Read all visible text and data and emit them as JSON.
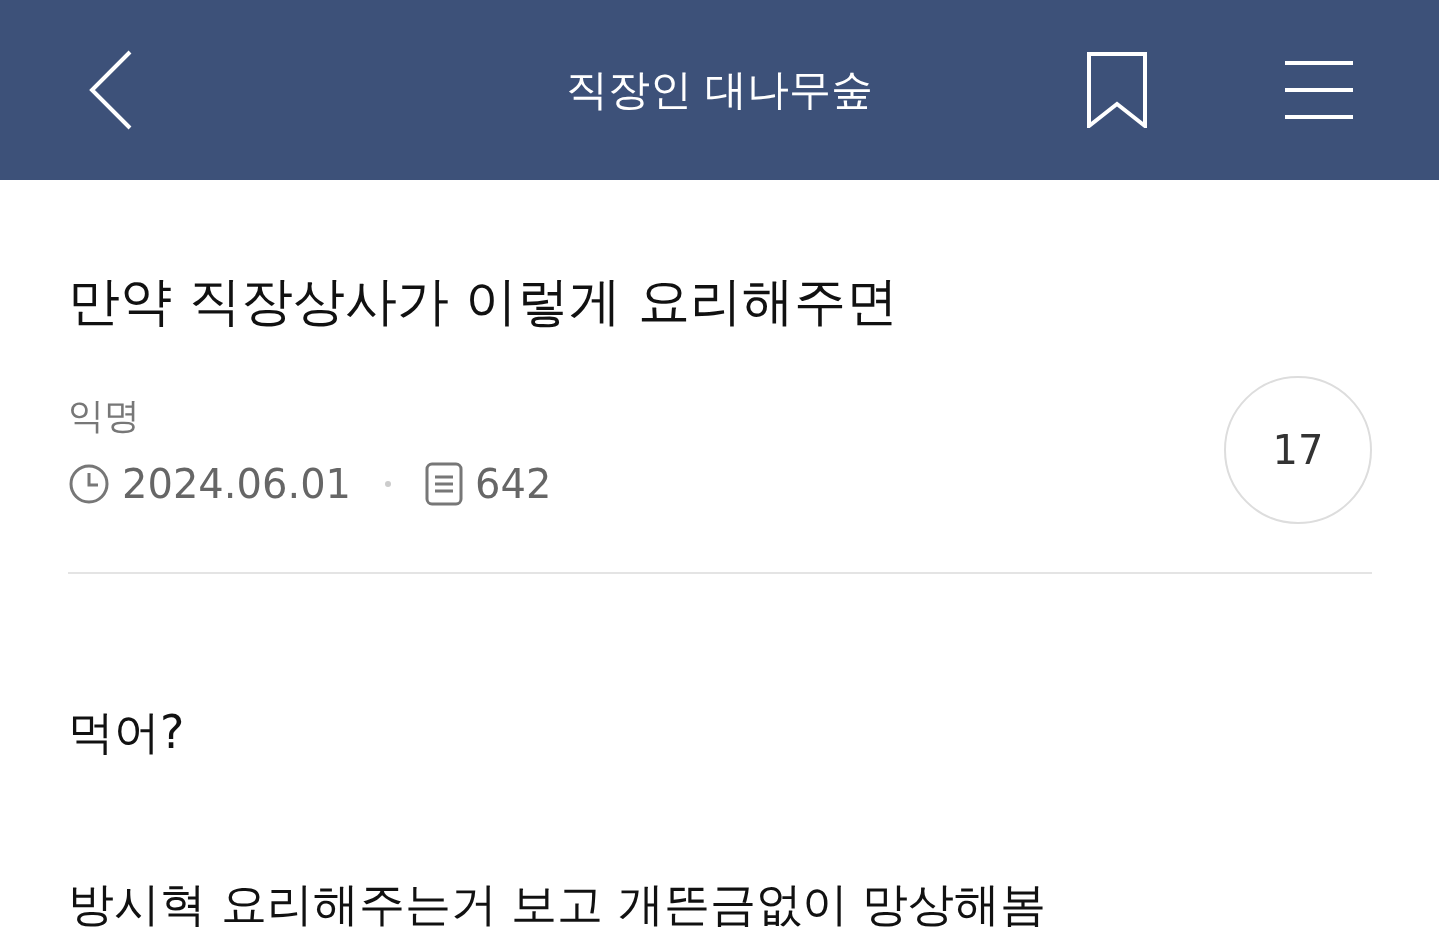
{
  "header": {
    "title": "직장인 대나무숲"
  },
  "post": {
    "title": "만약 직장상사가 이렇게 요리해주면",
    "author": "익명",
    "date": "2024.06.01",
    "views": "642",
    "comment_count": "17"
  },
  "body": [
    "먹어?",
    "방시혁 요리해주는거 보고 개뜬금없이 망상해봄"
  ]
}
